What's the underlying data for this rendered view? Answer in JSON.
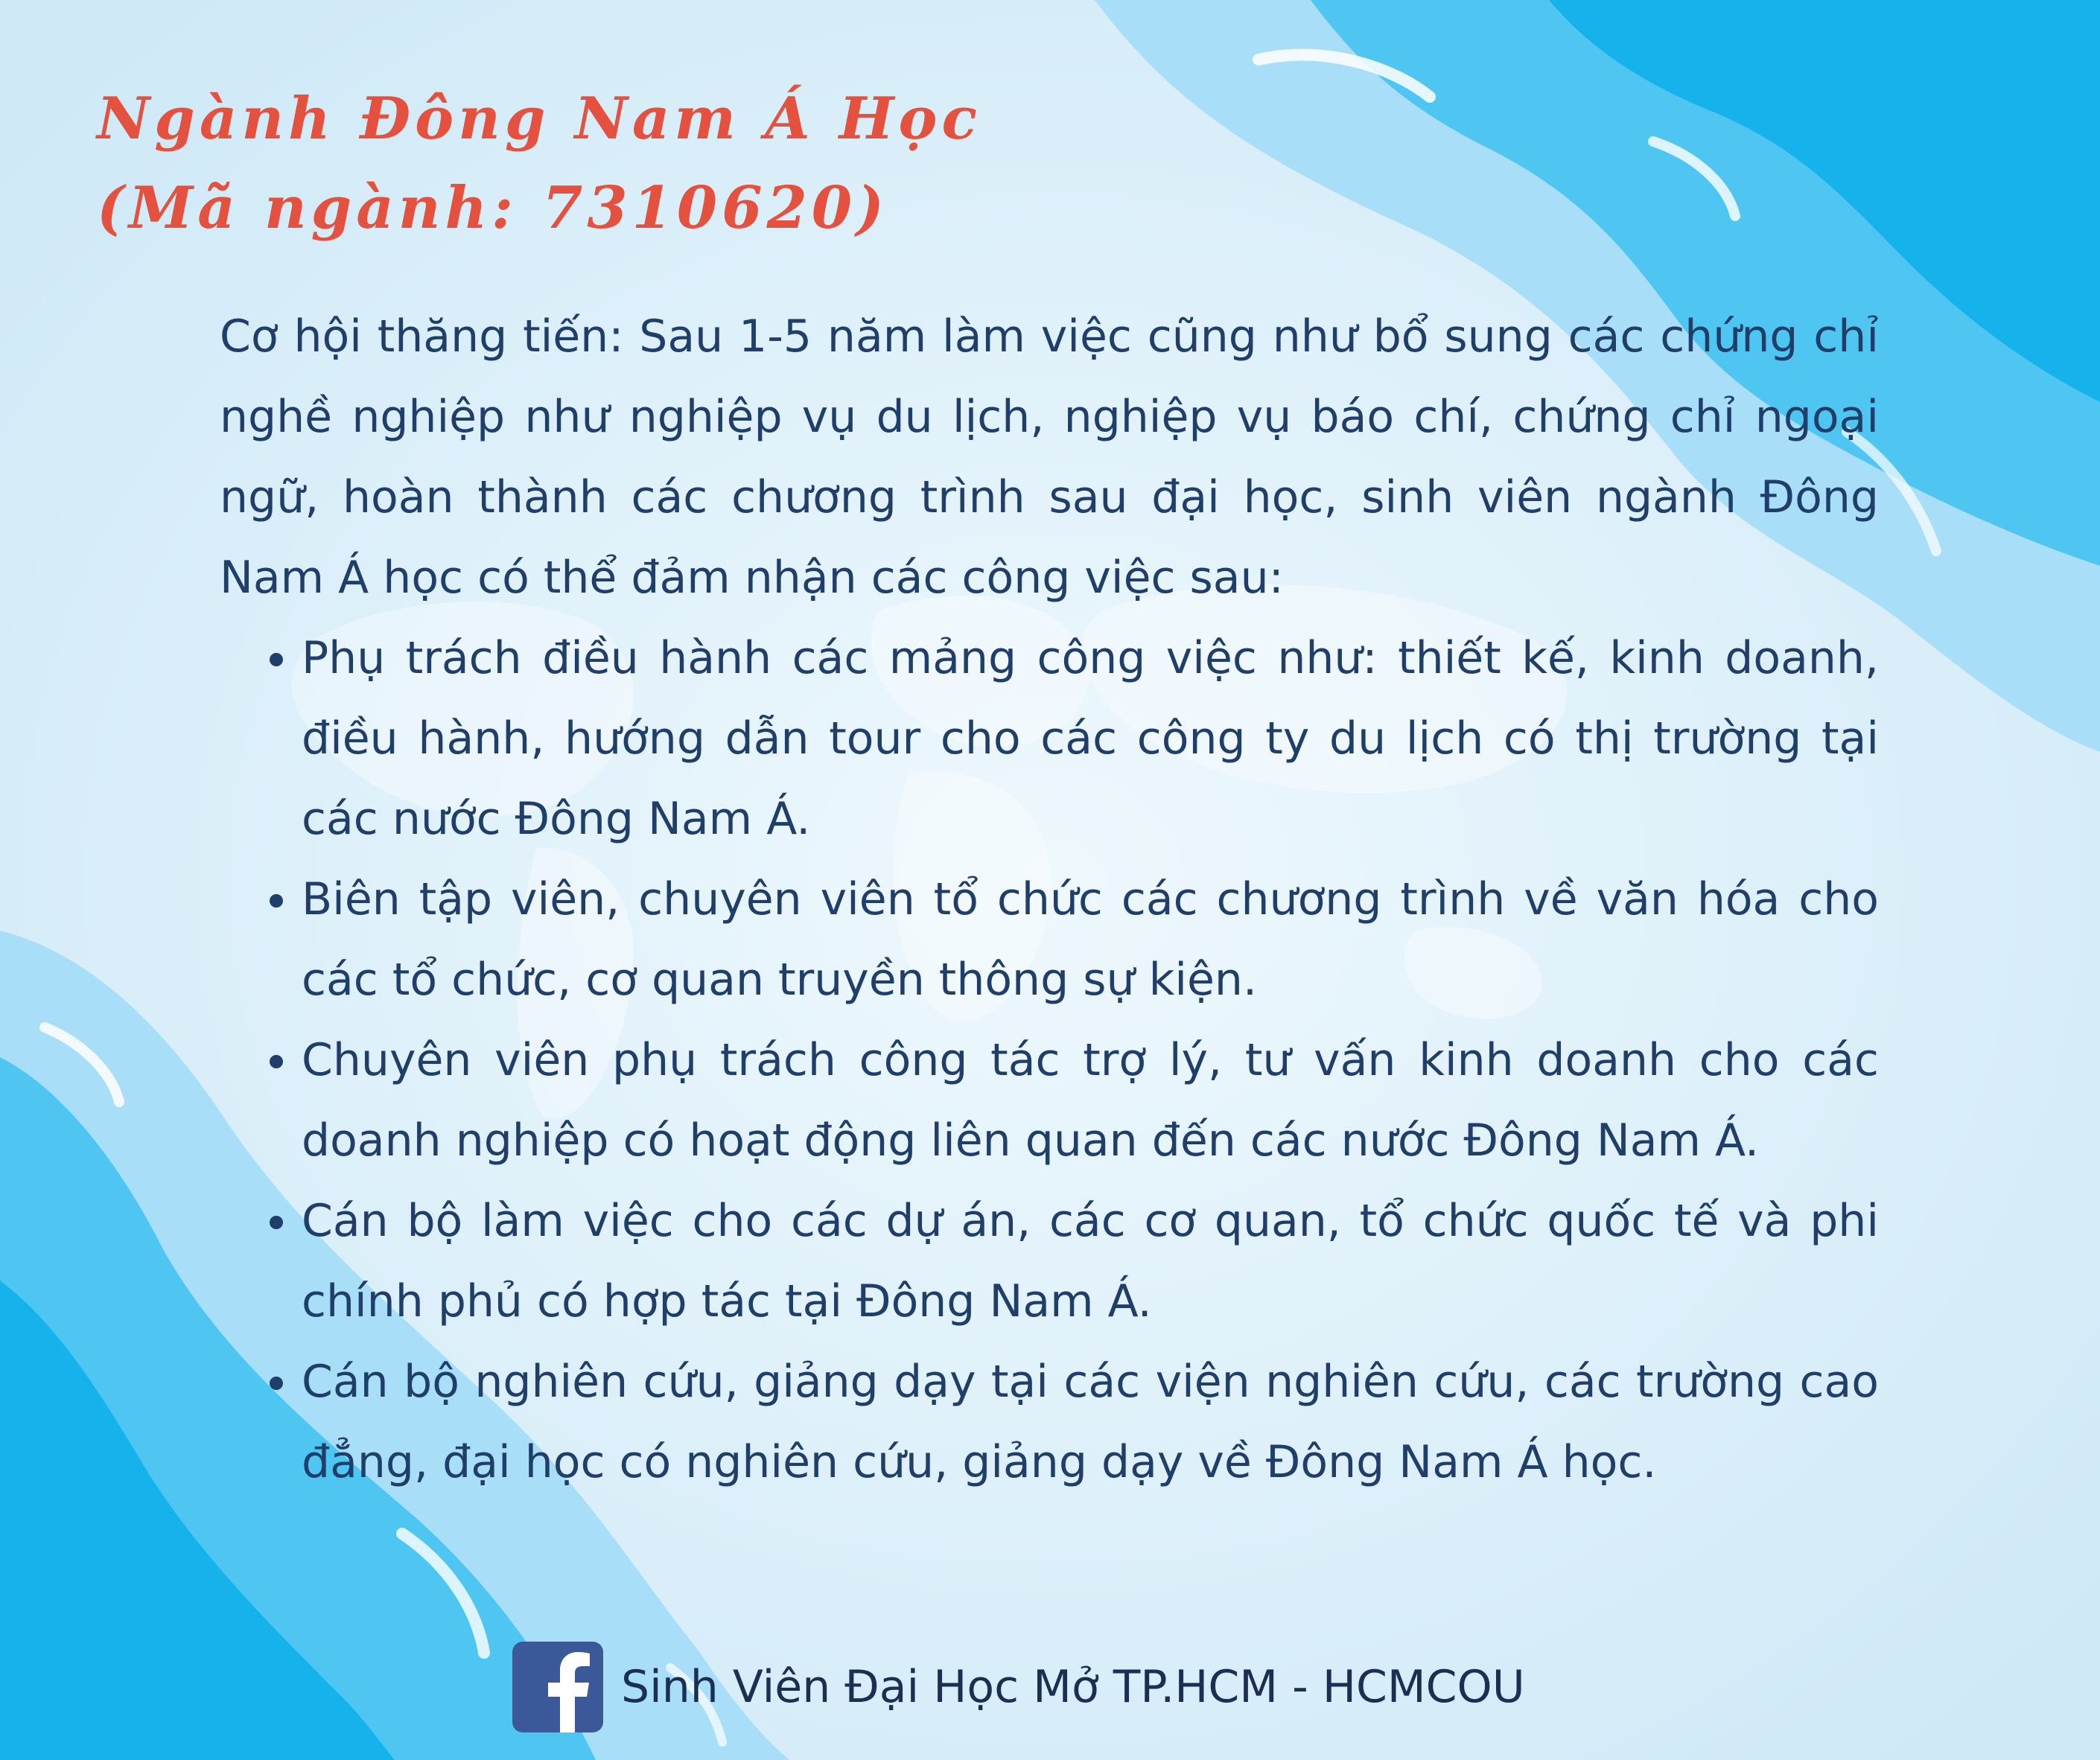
{
  "title": {
    "line1": "Ngành Đông Nam Á Học",
    "line2": "(Mã ngành: 7310620)"
  },
  "body": {
    "intro": "Cơ hội thăng tiến: Sau 1-5 năm làm việc cũng như bổ sung các chứng chỉ nghề nghiệp như nghiệp vụ du lịch, nghiệp vụ báo chí, chứng chỉ ngoại ngữ, hoàn thành các chương trình sau đại học, sinh viên ngành Đông Nam Á học có thể đảm nhận các công việc sau:",
    "items": [
      "Phụ trách điều hành các mảng công việc như: thiết kế, kinh doanh, điều hành, hướng dẫn tour cho các công ty du lịch có thị trường tại các nước Đông Nam Á.",
      "Biên tập viên, chuyên viên tổ chức các chương trình về văn hóa cho các tổ chức, cơ quan truyền thông sự kiện.",
      "Chuyên viên phụ trách công tác trợ lý, tư vấn kinh doanh cho các doanh nghiệp có hoạt động liên quan đến các nước Đông Nam Á.",
      "Cán bộ làm việc cho các dự án, các cơ quan, tổ chức quốc tế và phi chính phủ có hợp tác tại Đông Nam Á.",
      "Cán bộ nghiên cứu, giảng dạy tại các viện nghiên cứu, các trường cao đẳng, đại học có nghiên cứu, giảng dạy về Đông Nam Á học."
    ]
  },
  "footer": {
    "icon": "facebook-icon",
    "text": "Sinh Viên Đại Học Mở TP.HCM - HCMCOU"
  },
  "colors": {
    "title": "#e4513f",
    "body_text": "#1f3e6a",
    "wave_dark": "#15b2ec",
    "wave_mid": "#4fc6f2",
    "wave_light": "#a8def7",
    "background": "#d9eef9",
    "facebook": "#3b5998"
  }
}
